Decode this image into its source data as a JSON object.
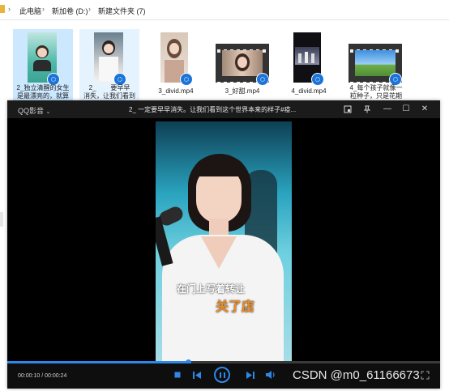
{
  "explorer": {
    "breadcrumb": [
      "此电脑",
      "新加卷 (D:)",
      "新建文件夹 (7)"
    ],
    "files": [
      {
        "name_line1": "2_独立清醒的女生",
        "name_line2": "是最漂亮的，就算"
      },
      {
        "name_line1": "2_        要早早",
        "name_line2": "消失，让我们看到"
      },
      {
        "name_line1": "3_divid.mp4",
        "name_line2": ""
      },
      {
        "name_line1": "3_好甜.mp4",
        "name_line2": ""
      },
      {
        "name_line1": "4_divid.mp4",
        "name_line2": ""
      },
      {
        "name_line1": "4_每个孩子就像一",
        "name_line2": "粒种子，只是花期"
      }
    ]
  },
  "player": {
    "brand": "QQ影音",
    "title": "2_   一定要早早消失。让我们看到这个世界本来的样子#疫...",
    "subtitle_line1": "在门上写着转让",
    "subtitle_line2": "关了店",
    "time": "00:00:10 / 00:00:24",
    "progress": 0.4167,
    "window_buttons": {
      "minimize": "—",
      "maximize": "☐",
      "close": "✕"
    }
  },
  "watermark": "CSDN @m0_61166673",
  "colors": {
    "accent": "#2e88e8",
    "badge": "#1b74d8",
    "orange_subtitle": "#f08a1e"
  },
  "icons": [
    "folder-icon",
    "chevron-right-icon",
    "video-badge-icon",
    "screenshot-icon",
    "pin-icon",
    "stop-icon",
    "prev-icon",
    "pause-icon",
    "next-icon",
    "volume-icon",
    "fullscreen-icon"
  ]
}
